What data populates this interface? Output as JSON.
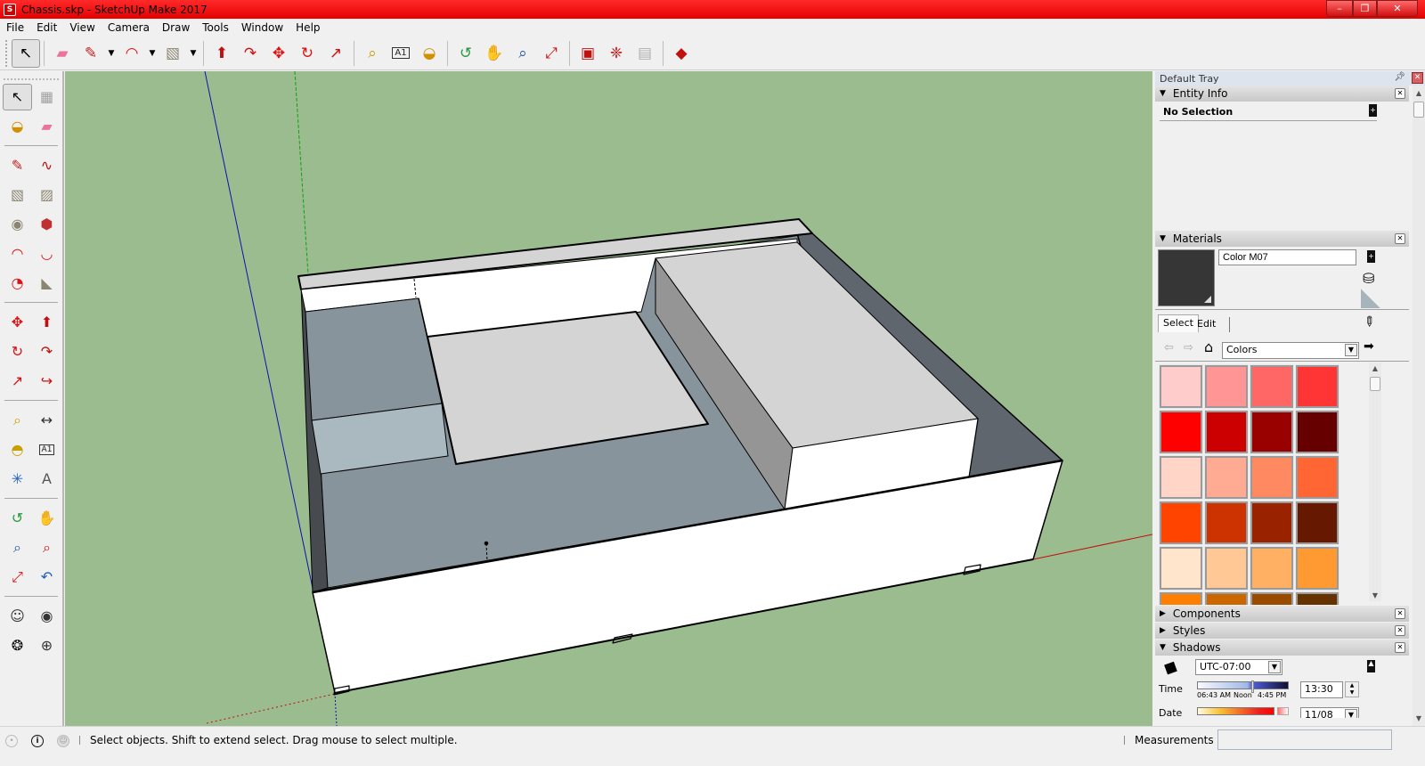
{
  "window": {
    "title": "Chassis.skp - SketchUp Make 2017",
    "controls": {
      "minimize": "–",
      "maximize": "❐",
      "close": "✕"
    }
  },
  "menu": [
    "File",
    "Edit",
    "View",
    "Camera",
    "Draw",
    "Tools",
    "Window",
    "Help"
  ],
  "toolbar": {
    "tools": [
      {
        "name": "select-tool",
        "glyph": "↖",
        "color": "#000000",
        "active": true
      },
      {
        "name": "eraser-tool",
        "glyph": "▰",
        "color": "#e8769a"
      },
      {
        "name": "pencil-tool",
        "glyph": "✎",
        "color": "#c02020",
        "dropdown": true
      },
      {
        "name": "arc-tool",
        "glyph": "◠",
        "color": "#e01010",
        "dropdown": true
      },
      {
        "name": "rectangle-tool",
        "glyph": "▧",
        "color": "#8a8470",
        "dropdown": true
      },
      {
        "name": "push-pull-tool",
        "glyph": "⬆",
        "color": "#c01010"
      },
      {
        "name": "follow-me-tool",
        "glyph": "↷",
        "color": "#d01010"
      },
      {
        "name": "move-tool",
        "glyph": "✥",
        "color": "#e01010"
      },
      {
        "name": "rotate-tool",
        "glyph": "↻",
        "color": "#e01010"
      },
      {
        "name": "scale-tool",
        "glyph": "↗",
        "color": "#d01010"
      },
      {
        "name": "tape-measure-tool",
        "glyph": "⌕",
        "color": "#c8a000"
      },
      {
        "name": "text-tool",
        "glyph": "A1",
        "color": "#222222"
      },
      {
        "name": "paint-bucket-tool",
        "glyph": "◒",
        "color": "#d09000"
      },
      {
        "name": "orbit-tool",
        "glyph": "↺",
        "color": "#2a9a40"
      },
      {
        "name": "pan-tool",
        "glyph": "✋",
        "color": "#d8b88a"
      },
      {
        "name": "zoom-tool",
        "glyph": "⌕",
        "color": "#2050a0"
      },
      {
        "name": "zoom-extents-tool",
        "glyph": "⤢",
        "color": "#d01010"
      },
      {
        "name": "3d-warehouse-icon",
        "glyph": "▣",
        "color": "#c01010"
      },
      {
        "name": "extension-warehouse-icon",
        "glyph": "❈",
        "color": "#c01010"
      },
      {
        "name": "share-model-icon",
        "glyph": "▤",
        "color": "#b0b0b0"
      },
      {
        "name": "ruby-console-icon",
        "glyph": "◆",
        "color": "#c01010"
      }
    ]
  },
  "left_toolbar": {
    "groups": [
      [
        [
          {
            "name": "select-tool",
            "glyph": "↖",
            "color": "#000000",
            "active": true
          },
          {
            "name": "make-component-tool",
            "glyph": "▦",
            "color": "#a0a0a0"
          }
        ],
        [
          {
            "name": "paint-bucket-tool",
            "glyph": "◒",
            "color": "#d09000"
          },
          {
            "name": "eraser-tool",
            "glyph": "▰",
            "color": "#e8769a"
          }
        ]
      ],
      [
        [
          {
            "name": "line-tool",
            "glyph": "✎",
            "color": "#c02020"
          },
          {
            "name": "freehand-tool",
            "glyph": "∿",
            "color": "#c01010"
          }
        ],
        [
          {
            "name": "rectangle-tool",
            "glyph": "▧",
            "color": "#8a8470"
          },
          {
            "name": "rotated-rectangle-tool",
            "glyph": "▨",
            "color": "#8a8470"
          }
        ],
        [
          {
            "name": "circle-tool",
            "glyph": "◉",
            "color": "#8a8470"
          },
          {
            "name": "polygon-tool",
            "glyph": "⬢",
            "color": "#c03030"
          }
        ],
        [
          {
            "name": "arc-tool",
            "glyph": "◠",
            "color": "#e01010"
          },
          {
            "name": "2point-arc-tool",
            "glyph": "◡",
            "color": "#e01010"
          }
        ],
        [
          {
            "name": "3point-arc-tool",
            "glyph": "◔",
            "color": "#e01010"
          },
          {
            "name": "pie-tool",
            "glyph": "◣",
            "color": "#8a8470"
          }
        ]
      ],
      [
        [
          {
            "name": "move-tool",
            "glyph": "✥",
            "color": "#e01010"
          },
          {
            "name": "push-pull-tool",
            "glyph": "⬆",
            "color": "#c01010"
          }
        ],
        [
          {
            "name": "rotate-tool",
            "glyph": "↻",
            "color": "#e01010"
          },
          {
            "name": "follow-me-tool",
            "glyph": "↷",
            "color": "#c01010"
          }
        ],
        [
          {
            "name": "scale-tool",
            "glyph": "↗",
            "color": "#d01010"
          },
          {
            "name": "offset-tool",
            "glyph": "↪",
            "color": "#d01010"
          }
        ]
      ],
      [
        [
          {
            "name": "tape-measure-tool",
            "glyph": "⌕",
            "color": "#c8a000"
          },
          {
            "name": "dimension-tool",
            "glyph": "↔",
            "color": "#333333"
          }
        ],
        [
          {
            "name": "protractor-tool",
            "glyph": "◓",
            "color": "#c8a000"
          },
          {
            "name": "text-tool",
            "glyph": "A1",
            "color": "#222222"
          }
        ],
        [
          {
            "name": "axes-tool",
            "glyph": "✳",
            "color": "#2060c0"
          },
          {
            "name": "3d-text-tool",
            "glyph": "A",
            "color": "#555555"
          }
        ]
      ],
      [
        [
          {
            "name": "orbit-tool",
            "glyph": "↺",
            "color": "#2a9a40"
          },
          {
            "name": "pan-tool",
            "glyph": "✋",
            "color": "#d8b88a"
          }
        ],
        [
          {
            "name": "zoom-tool",
            "glyph": "⌕",
            "color": "#2050a0"
          },
          {
            "name": "zoom-window-tool",
            "glyph": "⌕",
            "color": "#d01010"
          }
        ],
        [
          {
            "name": "zoom-extents-tool",
            "glyph": "⤢",
            "color": "#d01010"
          },
          {
            "name": "previous-view-tool",
            "glyph": "↶",
            "color": "#2060c0"
          }
        ]
      ],
      [
        [
          {
            "name": "position-camera-tool",
            "glyph": "☺",
            "color": "#333333"
          },
          {
            "name": "look-around-tool",
            "glyph": "◉",
            "color": "#333333"
          }
        ],
        [
          {
            "name": "walk-tool",
            "glyph": "❂",
            "color": "#111111"
          },
          {
            "name": "section-plane-tool",
            "glyph": "⊕",
            "color": "#333333"
          }
        ]
      ]
    ]
  },
  "viewport": {
    "background": "#9bbc8f",
    "axis_colors": {
      "red": "#c01010",
      "green": "#10a010",
      "blue": "#1010b0"
    },
    "face_colors": {
      "white": "#ffffff",
      "light_gray": "#d4d4d4",
      "mid_gray": "#959595",
      "slate": "#87949c",
      "light_slate": "#aab8c0",
      "dark_slate": "#5f666d",
      "darkest": "#474b4f"
    }
  },
  "tray": {
    "title": "Default Tray",
    "entity_info": {
      "header": "Entity Info",
      "selection": "No Selection"
    },
    "materials": {
      "header": "Materials",
      "material_name": "Color M07",
      "current_color": "#363636",
      "tabs": [
        "Select",
        "Edit"
      ],
      "active_tab": "Select",
      "library": "Colors",
      "swatches": [
        [
          "#ffcccc",
          "#ff9595",
          "#ff6666",
          "#ff3535"
        ],
        [
          "#ff0000",
          "#cc0000",
          "#990000",
          "#660000"
        ],
        [
          "#ffd5c8",
          "#ffaa92",
          "#ff8a62",
          "#ff6633"
        ],
        [
          "#ff4400",
          "#cc3300",
          "#992200",
          "#661900"
        ],
        [
          "#ffe5cc",
          "#ffc895",
          "#ffb062",
          "#ff9a33"
        ],
        [
          "#ff8000",
          "#cc6600",
          "#994c00",
          "#663300"
        ]
      ]
    },
    "components": {
      "header": "Components"
    },
    "styles": {
      "header": "Styles"
    },
    "shadows": {
      "header": "Shadows",
      "timezone": "UTC-07:00",
      "time_label": "Time",
      "time_start": "06:43 AM",
      "time_mid": "Noon",
      "time_end": "4:45 PM",
      "time_value": "13:30",
      "date_label": "Date",
      "date_value": "11/08"
    }
  },
  "status": {
    "message": "Select objects. Shift to extend select. Drag mouse to select multiple.",
    "measurements_label": "Measurements",
    "measurements_value": ""
  }
}
